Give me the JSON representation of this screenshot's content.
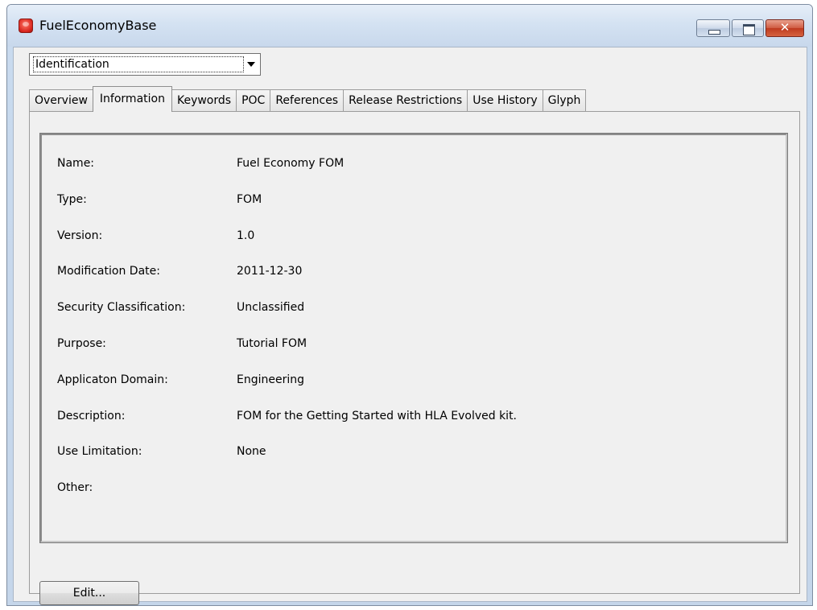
{
  "window": {
    "title": "FuelEconomyBase",
    "close_glyph": "✕"
  },
  "combo": {
    "selected": "Identification"
  },
  "tabs": [
    {
      "label": "Overview"
    },
    {
      "label": "Information",
      "active": true
    },
    {
      "label": "Keywords"
    },
    {
      "label": "POC"
    },
    {
      "label": "References"
    },
    {
      "label": "Release Restrictions"
    },
    {
      "label": "Use History"
    },
    {
      "label": "Glyph"
    }
  ],
  "info": [
    {
      "label": "Name:",
      "value": "Fuel Economy FOM"
    },
    {
      "label": "Type:",
      "value": "FOM"
    },
    {
      "label": "Version:",
      "value": "1.0"
    },
    {
      "label": "Modification Date:",
      "value": "2011-12-30"
    },
    {
      "label": "Security Classification:",
      "value": "Unclassified"
    },
    {
      "label": "Purpose:",
      "value": "Tutorial FOM"
    },
    {
      "label": "Applicaton Domain:",
      "value": "Engineering"
    },
    {
      "label": "Description:",
      "value": "FOM for the Getting Started with HLA Evolved kit."
    },
    {
      "label": "Use Limitation:",
      "value": "None"
    },
    {
      "label": "Other:",
      "value": ""
    }
  ],
  "buttons": {
    "edit": "Edit..."
  },
  "icons": {
    "app": "app-icon",
    "minimize": "minimize-icon",
    "maximize": "maximize-icon",
    "close": "close-icon",
    "dropdown": "chevron-down-icon"
  }
}
